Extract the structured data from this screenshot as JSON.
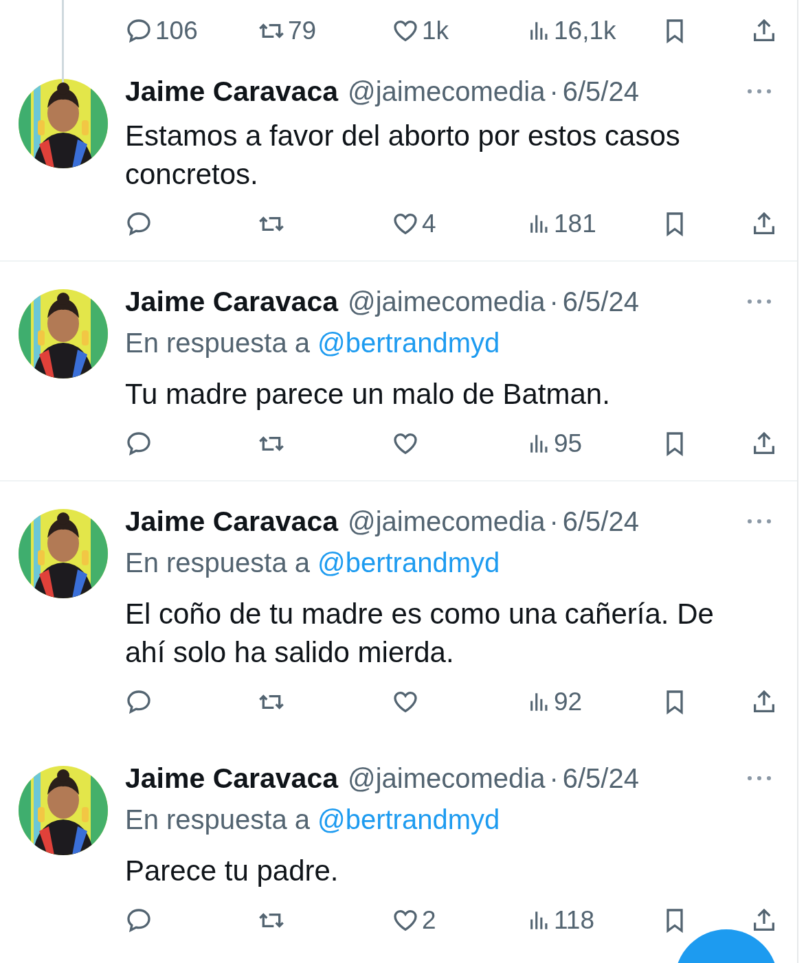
{
  "separator": "·",
  "top_actions": {
    "replies": "106",
    "reposts": "79",
    "likes": "1k",
    "views": "16,1k"
  },
  "tweets": [
    {
      "name": "Jaime Caravaca",
      "handle": "@jaimecomedia",
      "date": "6/5/24",
      "text": "Estamos a favor del aborto por estos casos concretos.",
      "divider": true,
      "actions": {
        "likes": "4",
        "views": "181"
      }
    },
    {
      "name": "Jaime Caravaca",
      "handle": "@jaimecomedia",
      "date": "6/5/24",
      "reply_prefix": "En respuesta a",
      "reply_to": "@bertrandmyd",
      "text": "Tu madre parece un malo de Batman.",
      "divider": true,
      "actions": {
        "views": "95"
      }
    },
    {
      "name": "Jaime Caravaca",
      "handle": "@jaimecomedia",
      "date": "6/5/24",
      "reply_prefix": "En respuesta a",
      "reply_to": "@bertrandmyd",
      "text": "El coño de tu madre es como una cañería. De ahí solo ha salido mierda.",
      "divider": false,
      "actions": {
        "views": "92"
      }
    },
    {
      "name": "Jaime Caravaca",
      "handle": "@jaimecomedia",
      "date": "6/5/24",
      "reply_prefix": "En respuesta a",
      "reply_to": "@bertrandmyd",
      "text": "Parece tu padre.",
      "divider": false,
      "actions": {
        "likes": "2",
        "views": "118"
      }
    }
  ]
}
